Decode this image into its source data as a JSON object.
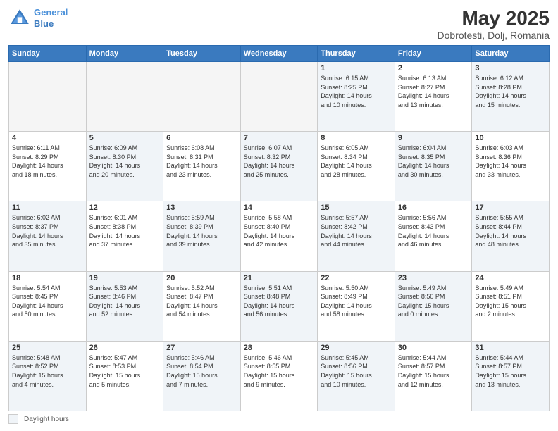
{
  "header": {
    "logo_line1": "General",
    "logo_line2": "Blue",
    "title": "May 2025",
    "location": "Dobrotesti, Dolj, Romania"
  },
  "weekdays": [
    "Sunday",
    "Monday",
    "Tuesday",
    "Wednesday",
    "Thursday",
    "Friday",
    "Saturday"
  ],
  "legend_label": "Daylight hours",
  "weeks": [
    [
      {
        "day": "",
        "info": "",
        "empty": true
      },
      {
        "day": "",
        "info": "",
        "empty": true
      },
      {
        "day": "",
        "info": "",
        "empty": true
      },
      {
        "day": "",
        "info": "",
        "empty": true
      },
      {
        "day": "1",
        "info": "Sunrise: 6:15 AM\nSunset: 8:25 PM\nDaylight: 14 hours\nand 10 minutes.",
        "shaded": true
      },
      {
        "day": "2",
        "info": "Sunrise: 6:13 AM\nSunset: 8:27 PM\nDaylight: 14 hours\nand 13 minutes.",
        "shaded": false
      },
      {
        "day": "3",
        "info": "Sunrise: 6:12 AM\nSunset: 8:28 PM\nDaylight: 14 hours\nand 15 minutes.",
        "shaded": true
      }
    ],
    [
      {
        "day": "4",
        "info": "Sunrise: 6:11 AM\nSunset: 8:29 PM\nDaylight: 14 hours\nand 18 minutes.",
        "shaded": false
      },
      {
        "day": "5",
        "info": "Sunrise: 6:09 AM\nSunset: 8:30 PM\nDaylight: 14 hours\nand 20 minutes.",
        "shaded": true
      },
      {
        "day": "6",
        "info": "Sunrise: 6:08 AM\nSunset: 8:31 PM\nDaylight: 14 hours\nand 23 minutes.",
        "shaded": false
      },
      {
        "day": "7",
        "info": "Sunrise: 6:07 AM\nSunset: 8:32 PM\nDaylight: 14 hours\nand 25 minutes.",
        "shaded": true
      },
      {
        "day": "8",
        "info": "Sunrise: 6:05 AM\nSunset: 8:34 PM\nDaylight: 14 hours\nand 28 minutes.",
        "shaded": false
      },
      {
        "day": "9",
        "info": "Sunrise: 6:04 AM\nSunset: 8:35 PM\nDaylight: 14 hours\nand 30 minutes.",
        "shaded": true
      },
      {
        "day": "10",
        "info": "Sunrise: 6:03 AM\nSunset: 8:36 PM\nDaylight: 14 hours\nand 33 minutes.",
        "shaded": false
      }
    ],
    [
      {
        "day": "11",
        "info": "Sunrise: 6:02 AM\nSunset: 8:37 PM\nDaylight: 14 hours\nand 35 minutes.",
        "shaded": true
      },
      {
        "day": "12",
        "info": "Sunrise: 6:01 AM\nSunset: 8:38 PM\nDaylight: 14 hours\nand 37 minutes.",
        "shaded": false
      },
      {
        "day": "13",
        "info": "Sunrise: 5:59 AM\nSunset: 8:39 PM\nDaylight: 14 hours\nand 39 minutes.",
        "shaded": true
      },
      {
        "day": "14",
        "info": "Sunrise: 5:58 AM\nSunset: 8:40 PM\nDaylight: 14 hours\nand 42 minutes.",
        "shaded": false
      },
      {
        "day": "15",
        "info": "Sunrise: 5:57 AM\nSunset: 8:42 PM\nDaylight: 14 hours\nand 44 minutes.",
        "shaded": true
      },
      {
        "day": "16",
        "info": "Sunrise: 5:56 AM\nSunset: 8:43 PM\nDaylight: 14 hours\nand 46 minutes.",
        "shaded": false
      },
      {
        "day": "17",
        "info": "Sunrise: 5:55 AM\nSunset: 8:44 PM\nDaylight: 14 hours\nand 48 minutes.",
        "shaded": true
      }
    ],
    [
      {
        "day": "18",
        "info": "Sunrise: 5:54 AM\nSunset: 8:45 PM\nDaylight: 14 hours\nand 50 minutes.",
        "shaded": false
      },
      {
        "day": "19",
        "info": "Sunrise: 5:53 AM\nSunset: 8:46 PM\nDaylight: 14 hours\nand 52 minutes.",
        "shaded": true
      },
      {
        "day": "20",
        "info": "Sunrise: 5:52 AM\nSunset: 8:47 PM\nDaylight: 14 hours\nand 54 minutes.",
        "shaded": false
      },
      {
        "day": "21",
        "info": "Sunrise: 5:51 AM\nSunset: 8:48 PM\nDaylight: 14 hours\nand 56 minutes.",
        "shaded": true
      },
      {
        "day": "22",
        "info": "Sunrise: 5:50 AM\nSunset: 8:49 PM\nDaylight: 14 hours\nand 58 minutes.",
        "shaded": false
      },
      {
        "day": "23",
        "info": "Sunrise: 5:49 AM\nSunset: 8:50 PM\nDaylight: 15 hours\nand 0 minutes.",
        "shaded": true
      },
      {
        "day": "24",
        "info": "Sunrise: 5:49 AM\nSunset: 8:51 PM\nDaylight: 15 hours\nand 2 minutes.",
        "shaded": false
      }
    ],
    [
      {
        "day": "25",
        "info": "Sunrise: 5:48 AM\nSunset: 8:52 PM\nDaylight: 15 hours\nand 4 minutes.",
        "shaded": true
      },
      {
        "day": "26",
        "info": "Sunrise: 5:47 AM\nSunset: 8:53 PM\nDaylight: 15 hours\nand 5 minutes.",
        "shaded": false
      },
      {
        "day": "27",
        "info": "Sunrise: 5:46 AM\nSunset: 8:54 PM\nDaylight: 15 hours\nand 7 minutes.",
        "shaded": true
      },
      {
        "day": "28",
        "info": "Sunrise: 5:46 AM\nSunset: 8:55 PM\nDaylight: 15 hours\nand 9 minutes.",
        "shaded": false
      },
      {
        "day": "29",
        "info": "Sunrise: 5:45 AM\nSunset: 8:56 PM\nDaylight: 15 hours\nand 10 minutes.",
        "shaded": true
      },
      {
        "day": "30",
        "info": "Sunrise: 5:44 AM\nSunset: 8:57 PM\nDaylight: 15 hours\nand 12 minutes.",
        "shaded": false
      },
      {
        "day": "31",
        "info": "Sunrise: 5:44 AM\nSunset: 8:57 PM\nDaylight: 15 hours\nand 13 minutes.",
        "shaded": true
      }
    ]
  ]
}
